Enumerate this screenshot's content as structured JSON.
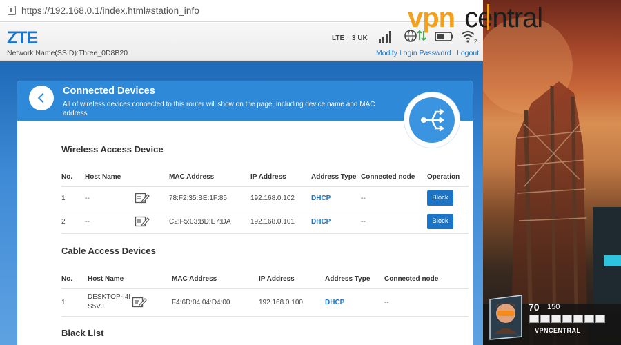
{
  "browser": {
    "url": "https://192.168.0.1/index.html#station_info"
  },
  "header": {
    "logo": "ZTE",
    "ssid": "Network Name(SSID):Three_0D8B20",
    "network_type": "LTE",
    "carrier": "3 UK",
    "wifi_clients": "2",
    "modify_password": "Modify Login Password",
    "logout": "Logout"
  },
  "page": {
    "title": "Connected Devices",
    "description": "All of wireless devices connected to this router will show on the page, including device name and MAC address"
  },
  "wireless": {
    "section_title": "Wireless Access Device",
    "columns": [
      "No.",
      "Host Name",
      "MAC Address",
      "IP Address",
      "Address Type",
      "Connected node",
      "Operation"
    ],
    "rows": [
      {
        "no": "1",
        "host": "--",
        "mac": "78:F2:35:BE:1F:85",
        "ip": "192.168.0.102",
        "type": "DHCP",
        "node": "--",
        "action": "Block"
      },
      {
        "no": "2",
        "host": "--",
        "mac": "C2:F5:03:BD:E7:DA",
        "ip": "192.168.0.101",
        "type": "DHCP",
        "node": "--",
        "action": "Block"
      }
    ]
  },
  "cable": {
    "section_title": "Cable Access Devices",
    "columns": [
      "No.",
      "Host Name",
      "MAC Address",
      "IP Address",
      "Address Type",
      "Connected node"
    ],
    "rows": [
      {
        "no": "1",
        "host": "DESKTOP-I4IS5VJ",
        "mac": "F4:6D:04:04:D4:00",
        "ip": "192.168.0.100",
        "type": "DHCP",
        "node": "--"
      }
    ]
  },
  "blacklist": {
    "section_title": "Black List"
  },
  "overlay": {
    "watermark_vpn": "vpn",
    "watermark_central": "central",
    "hud_health": "70",
    "hud_max_health": "150",
    "hud_player": "VPNCENTRAL"
  },
  "colors": {
    "accent": "#1c74c6",
    "banner": "#2e8ad9",
    "watermark_orange": "#f3a11d"
  }
}
